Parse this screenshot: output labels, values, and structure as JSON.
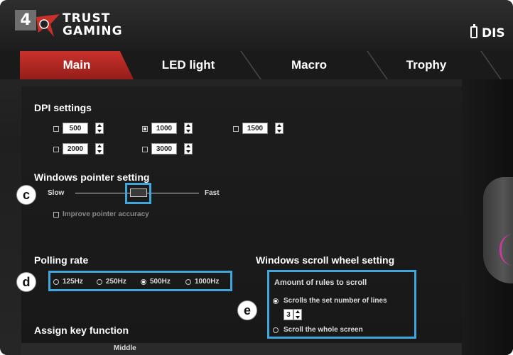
{
  "header": {
    "step_badge": "4",
    "brand_line1": "TRUST",
    "brand_line2": "GAMING",
    "right_label": "DIS"
  },
  "tabs": [
    {
      "label": "Main",
      "active": true
    },
    {
      "label": "LED light",
      "active": false
    },
    {
      "label": "Macro",
      "active": false
    },
    {
      "label": "Trophy",
      "active": false
    }
  ],
  "dpi": {
    "title": "DPI settings",
    "options": [
      {
        "value": "500",
        "checked": false
      },
      {
        "value": "1000",
        "checked": true
      },
      {
        "value": "1500",
        "checked": false
      },
      {
        "value": "2000",
        "checked": false
      },
      {
        "value": "3000",
        "checked": false
      }
    ]
  },
  "pointer": {
    "title": "Windows pointer setting",
    "slow_label": "Slow",
    "fast_label": "Fast",
    "improve_label": "Improve pointer accuracy",
    "improve_checked": false,
    "speed_level": 0.5
  },
  "polling": {
    "title": "Polling rate",
    "options": [
      {
        "label": "125Hz",
        "selected": false
      },
      {
        "label": "250Hz",
        "selected": false
      },
      {
        "label": "500Hz",
        "selected": true
      },
      {
        "label": "1000Hz",
        "selected": false
      }
    ]
  },
  "scroll": {
    "title": "Windows scroll wheel setting",
    "group_title": "Amount of rules to scroll",
    "option1": "Scrolls the set number of lines",
    "lines_value": "3",
    "option2": "Scroll the whole screen",
    "option1_selected": true,
    "option2_selected": false
  },
  "assign": {
    "title": "Assign key function",
    "partial_col": "Middle"
  },
  "callouts": {
    "c": "c",
    "d": "d",
    "e": "e"
  },
  "colors": {
    "accent_tab": "#c9322c",
    "highlight": "#3fa7dc",
    "background": "#1f1f1f"
  }
}
